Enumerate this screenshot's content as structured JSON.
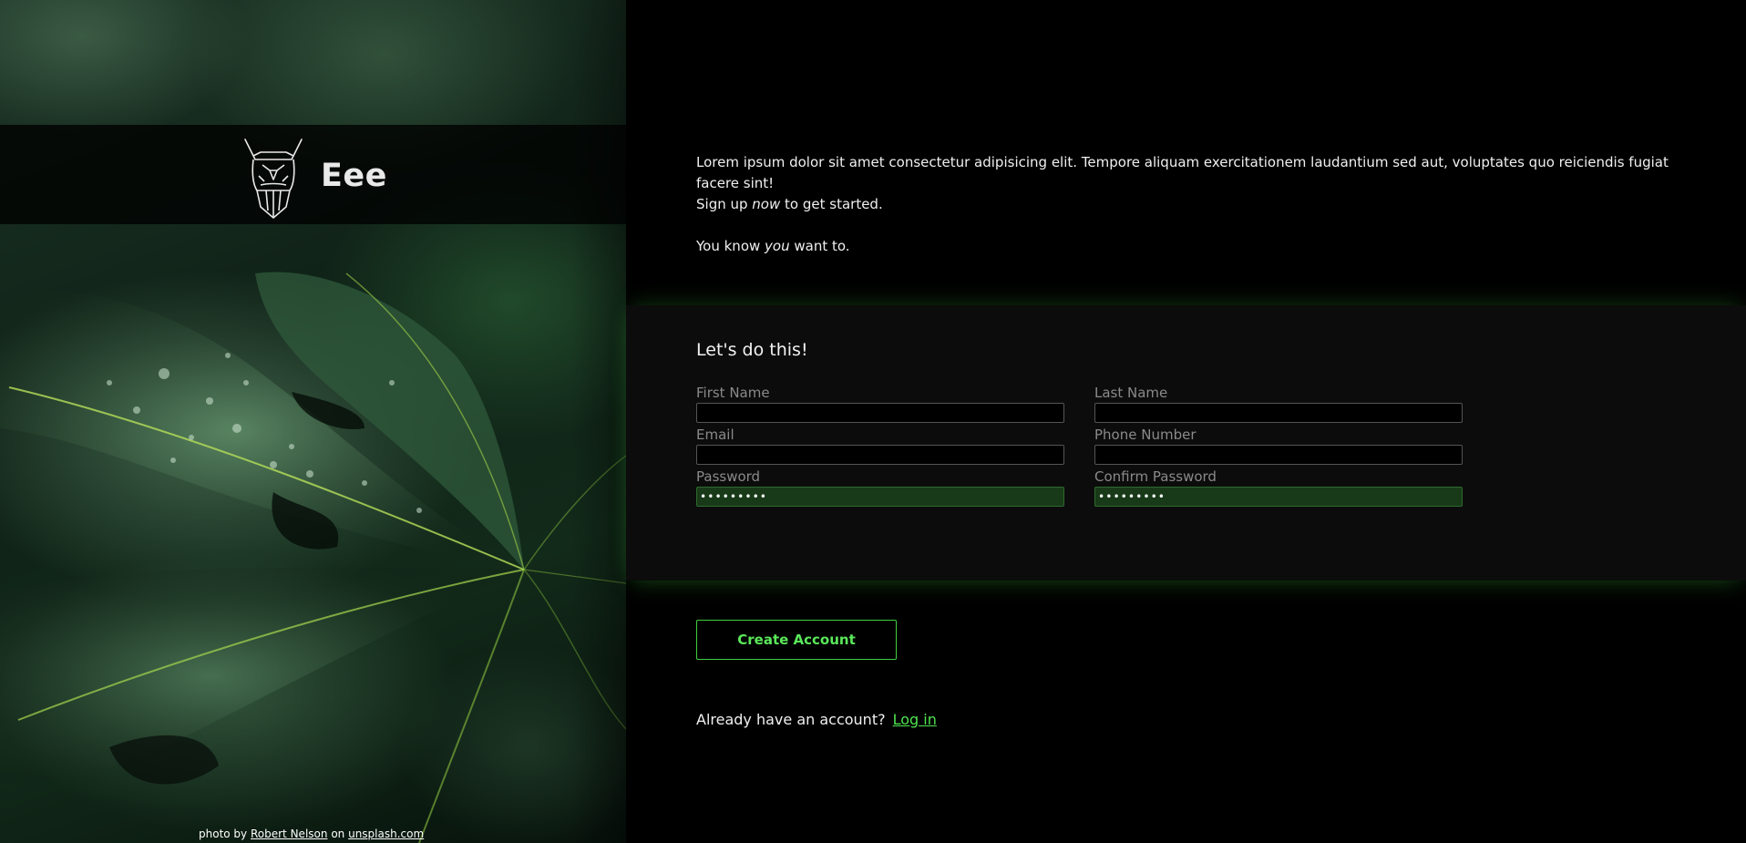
{
  "brand": {
    "name": "Eee",
    "logo_icon": "viking-helmet-icon"
  },
  "photo_credit": {
    "prefix": "photo by",
    "author": "Robert Nelson",
    "middle": "on",
    "site": "unsplash.com"
  },
  "intro": {
    "paragraph": "Lorem ipsum dolor sit amet consectetur adipisicing elit. Tempore aliquam exercitationem laudantium sed aut, voluptates quo reiciendis fugiat facere sint!",
    "signup_prefix": "Sign up",
    "signup_emphasis": "now",
    "signup_suffix": "to get started.",
    "know_prefix": "You know",
    "know_emphasis": "you",
    "know_suffix": "want to."
  },
  "form": {
    "title": "Let's do this!",
    "fields": {
      "first_name": {
        "label": "First Name",
        "value": ""
      },
      "last_name": {
        "label": "Last Name",
        "value": ""
      },
      "email": {
        "label": "Email",
        "value": ""
      },
      "phone": {
        "label": "Phone Number",
        "value": ""
      },
      "password": {
        "label": "Password",
        "value": "•••••••••"
      },
      "confirm_password": {
        "label": "Confirm Password",
        "value": "•••••••••"
      }
    }
  },
  "actions": {
    "create_account_label": "Create Account",
    "login_prompt": "Already have an account?",
    "login_link": "Log in"
  },
  "colors": {
    "accent": "#4fe34f",
    "background": "#000000",
    "form_background": "#0c0c0c",
    "filled_input": "#183a18"
  }
}
